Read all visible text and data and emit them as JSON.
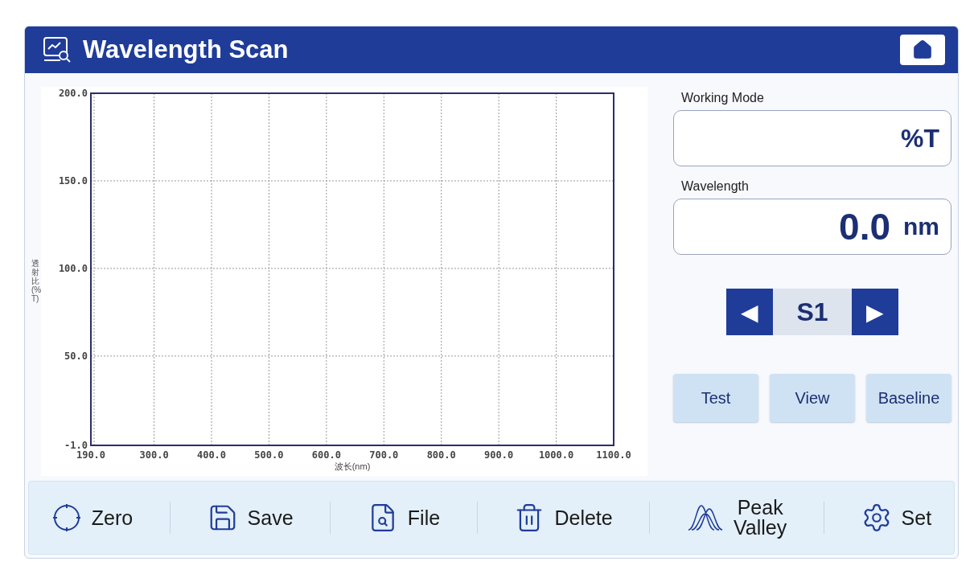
{
  "window": {
    "title": "Wavelength Scan"
  },
  "chart": {
    "chart_data": {
      "type": "line",
      "grid": true,
      "xlabel": "波长(nm)",
      "ylabel": "透射比(%T)",
      "xlim": [
        190,
        1100
      ],
      "ylim": [
        -1,
        200
      ],
      "xticks": [
        {
          "value": 190,
          "label": "190.0"
        },
        {
          "value": 300,
          "label": "300.0"
        },
        {
          "value": 400,
          "label": "400.0"
        },
        {
          "value": 500,
          "label": "500.0"
        },
        {
          "value": 600,
          "label": "600.0"
        },
        {
          "value": 700,
          "label": "700.0"
        },
        {
          "value": 800,
          "label": "800.0"
        },
        {
          "value": 900,
          "label": "900.0"
        },
        {
          "value": 1000,
          "label": "1000.0"
        },
        {
          "value": 1100,
          "label": "1100.0"
        }
      ],
      "yticks": [
        {
          "value": -1,
          "label": "-1.0"
        },
        {
          "value": 50,
          "label": "50.0"
        },
        {
          "value": 100,
          "label": "100.0"
        },
        {
          "value": 150,
          "label": "150.0"
        },
        {
          "value": 200,
          "label": "200.0"
        }
      ]
    }
  },
  "working_mode": {
    "label": "Working Mode",
    "value": "%T"
  },
  "wavelength": {
    "label": "Wavelength",
    "value": "0.0",
    "unit": "nm"
  },
  "sample_selector": {
    "prev": "◀",
    "value": "S1",
    "next": "▶"
  },
  "actions": [
    "Test",
    "View",
    "Baseline"
  ],
  "toolbar": [
    {
      "kind": "zero",
      "label": "Zero"
    },
    {
      "kind": "save",
      "label": "Save"
    },
    {
      "kind": "file",
      "label": "File"
    },
    {
      "kind": "delete",
      "label": "Delete"
    },
    {
      "kind": "peak",
      "label": "Peak\nValley"
    },
    {
      "kind": "set",
      "label": "Set"
    }
  ]
}
